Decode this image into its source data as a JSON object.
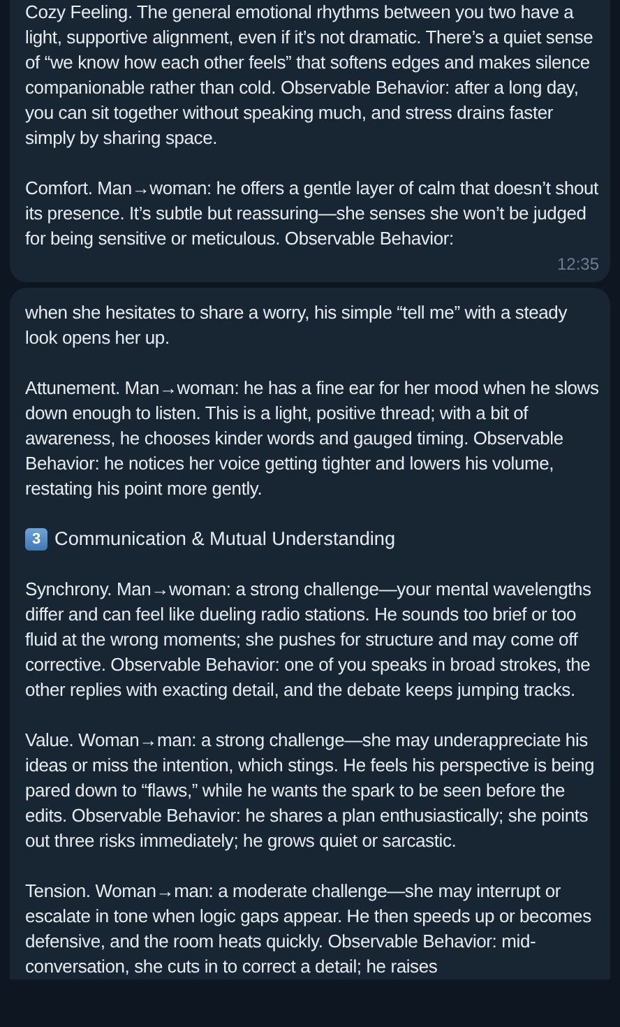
{
  "messages": [
    {
      "blocks": [
        {
          "kind": "text",
          "text": "Cozy Feeling. The general emotional rhythms between you two have a light, supportive alignment, even if it’s not dramatic. There’s a quiet sense of “we know how each other feels” that softens edges and makes silence companionable rather than cold. Observable Behavior: after a long day, you can sit together without speaking much, and stress drains faster simply by sharing space."
        },
        {
          "kind": "text",
          "text": "Comfort. Man→woman: he offers a gentle layer of calm that doesn’t shout its presence. It’s subtle but reassuring—she senses she won’t be judged for being sensitive or meticulous. Observable Behavior:"
        }
      ],
      "time": "12:35"
    },
    {
      "blocks": [
        {
          "kind": "text",
          "text": "when she hesitates to share a worry, his simple “tell me” with a steady look opens her up."
        },
        {
          "kind": "text",
          "text": "Attunement. Man→woman: he has a fine ear for her mood when he slows down enough to listen. This is a light, positive thread; with a bit of awareness, he chooses kinder words and gauged timing. Observable Behavior: he notices her voice getting tighter and lowers his volume, restating his point more gently."
        },
        {
          "kind": "heading",
          "number": "3",
          "text": "Communication & Mutual Understanding"
        },
        {
          "kind": "text",
          "text": "Synchrony. Man→woman: a strong challenge—your mental wavelengths differ and can feel like dueling radio stations. He sounds too brief or too fluid at the wrong moments; she pushes for structure and may come off corrective. Observable Behavior: one of you speaks in broad strokes, the other replies with exacting detail, and the debate keeps jumping tracks."
        },
        {
          "kind": "text",
          "text": "Value. Woman→man: a strong challenge—she may underappreciate his ideas or miss the intention, which stings. He feels his perspective is being pared down to “flaws,” while he wants the spark to be seen before the edits. Observable Behavior: he shares a plan enthusiastically; she points out three risks immediately; he grows quiet or sarcastic."
        },
        {
          "kind": "text",
          "text": "Tension. Woman→man: a moderate challenge—she may interrupt or escalate in tone when logic gaps appear. He then speeds up or becomes defensive, and the room heats quickly. Observable Behavior: mid-conversation, she cuts in to correct a detail; he raises"
        }
      ]
    }
  ]
}
